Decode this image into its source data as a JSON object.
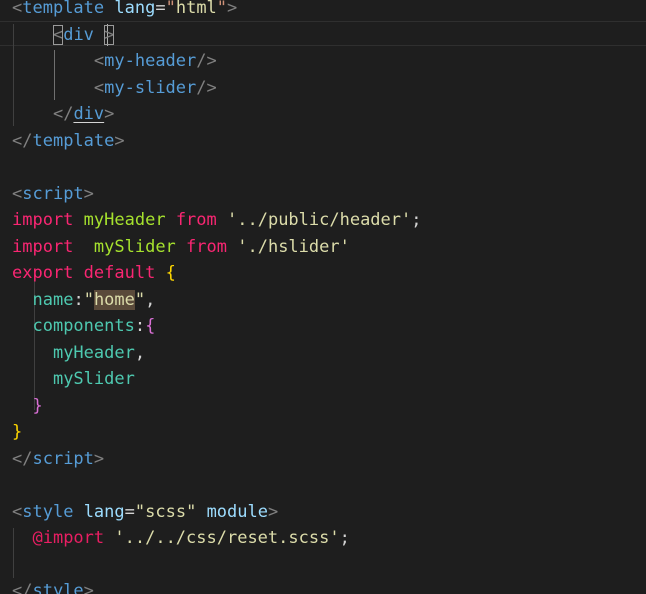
{
  "editor": {
    "lines": [
      {
        "tokens": [
          [
            "punct",
            "<"
          ],
          [
            "tag",
            "template"
          ],
          [
            "plain",
            " "
          ],
          [
            "attr",
            "lang"
          ],
          [
            "eq",
            "="
          ],
          [
            "str",
            "\""
          ],
          [
            "str2",
            "html"
          ],
          [
            "str",
            "\""
          ],
          [
            "punct",
            ">"
          ]
        ]
      },
      {
        "tokens": [
          [
            "plain",
            "    "
          ],
          [
            "punct",
            "<"
          ],
          [
            "tag",
            "div"
          ],
          [
            "plain",
            " "
          ],
          [
            "punct",
            ">"
          ]
        ]
      },
      {
        "tokens": [
          [
            "plain",
            "        "
          ],
          [
            "punct",
            "<"
          ],
          [
            "tag",
            "my-header"
          ],
          [
            "punct",
            "/>"
          ]
        ]
      },
      {
        "tokens": [
          [
            "plain",
            "        "
          ],
          [
            "punct",
            "<"
          ],
          [
            "tag",
            "my-slider"
          ],
          [
            "punct",
            "/>"
          ]
        ]
      },
      {
        "tokens": [
          [
            "plain",
            "    "
          ],
          [
            "punct",
            "</"
          ],
          [
            "tag",
            "div"
          ],
          [
            "punct",
            ">"
          ]
        ]
      },
      {
        "tokens": [
          [
            "punct",
            "</"
          ],
          [
            "tag",
            "template"
          ],
          [
            "punct",
            ">"
          ]
        ]
      },
      {
        "tokens": []
      },
      {
        "tokens": [
          [
            "punct",
            "<"
          ],
          [
            "tag",
            "script"
          ],
          [
            "punct",
            ">"
          ]
        ]
      },
      {
        "tokens": [
          [
            "kw",
            "import"
          ],
          [
            "plain",
            " "
          ],
          [
            "id",
            "myHeader"
          ],
          [
            "plain",
            " "
          ],
          [
            "kw",
            "from"
          ],
          [
            "plain",
            " "
          ],
          [
            "str2",
            "'../public/header'"
          ],
          [
            "plain",
            ";"
          ]
        ]
      },
      {
        "tokens": [
          [
            "kw",
            "import"
          ],
          [
            "plain",
            "  "
          ],
          [
            "id",
            "mySlider"
          ],
          [
            "plain",
            " "
          ],
          [
            "kw",
            "from"
          ],
          [
            "plain",
            " "
          ],
          [
            "str2",
            "'./hslider'"
          ]
        ]
      },
      {
        "tokens": [
          [
            "kw",
            "export"
          ],
          [
            "plain",
            " "
          ],
          [
            "kw",
            "default"
          ],
          [
            "plain",
            " "
          ],
          [
            "brace1",
            "{"
          ]
        ]
      },
      {
        "tokens": [
          [
            "plain",
            "  "
          ],
          [
            "prop",
            "name"
          ],
          [
            "plain",
            ":"
          ],
          [
            "str2",
            "\""
          ],
          [
            "hl",
            "home"
          ],
          [
            "str2",
            "\""
          ],
          [
            "plain",
            ","
          ]
        ]
      },
      {
        "tokens": [
          [
            "plain",
            "  "
          ],
          [
            "prop",
            "components"
          ],
          [
            "plain",
            ":"
          ],
          [
            "brace2",
            "{"
          ]
        ]
      },
      {
        "tokens": [
          [
            "plain",
            "    "
          ],
          [
            "prop",
            "myHeader"
          ],
          [
            "plain",
            ","
          ]
        ]
      },
      {
        "tokens": [
          [
            "plain",
            "    "
          ],
          [
            "prop",
            "mySlider"
          ]
        ]
      },
      {
        "tokens": [
          [
            "plain",
            "  "
          ],
          [
            "brace2",
            "}"
          ]
        ]
      },
      {
        "tokens": [
          [
            "brace1",
            "}"
          ]
        ]
      },
      {
        "tokens": [
          [
            "punct",
            "</"
          ],
          [
            "tag",
            "script"
          ],
          [
            "punct",
            ">"
          ]
        ]
      },
      {
        "tokens": []
      },
      {
        "tokens": [
          [
            "punct",
            "<"
          ],
          [
            "tag",
            "style"
          ],
          [
            "plain",
            " "
          ],
          [
            "attr",
            "lang"
          ],
          [
            "eq",
            "="
          ],
          [
            "str2",
            "\"scss\""
          ],
          [
            "plain",
            " "
          ],
          [
            "attr",
            "module"
          ],
          [
            "punct",
            ">"
          ]
        ]
      },
      {
        "tokens": [
          [
            "plain",
            "  "
          ],
          [
            "at",
            "@import"
          ],
          [
            "plain",
            " "
          ],
          [
            "str2",
            "'../../css/reset.scss'"
          ],
          [
            "plain",
            ";"
          ]
        ]
      },
      {
        "tokens": []
      },
      {
        "tokens": [
          [
            "punct",
            "</"
          ],
          [
            "tag",
            "style"
          ],
          [
            "punct",
            ">"
          ]
        ]
      }
    ]
  }
}
